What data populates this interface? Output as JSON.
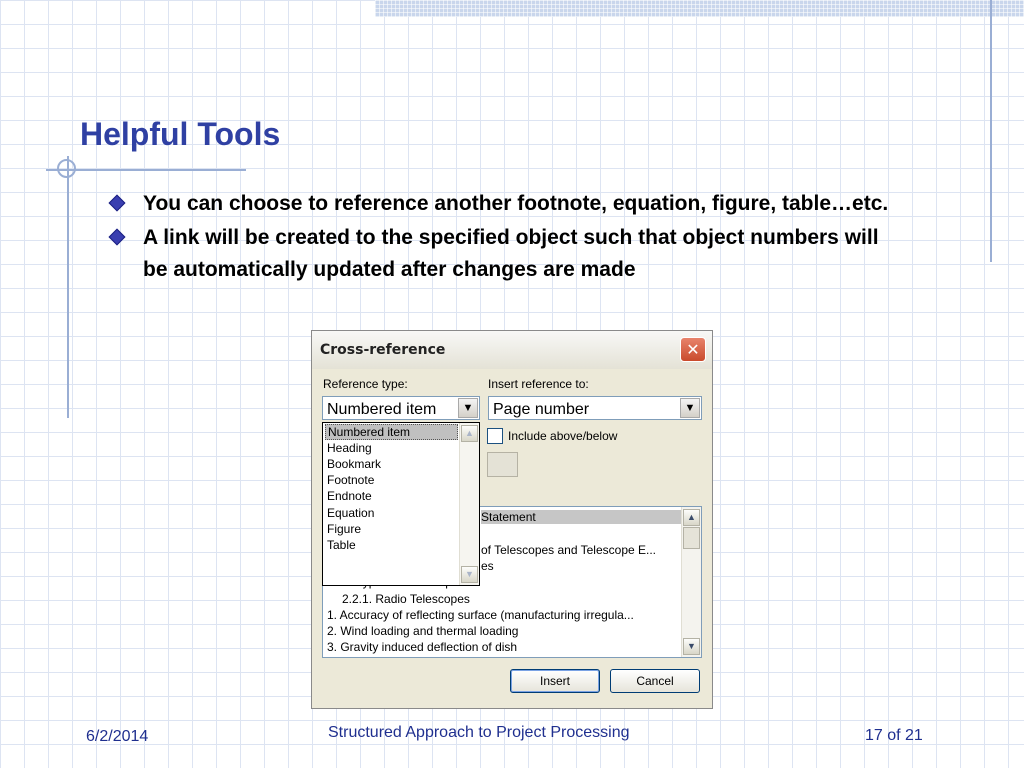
{
  "slide": {
    "title": "Helpful Tools",
    "bullets": [
      "You can choose to reference another footnote, equation, figure, table…etc.",
      "A link will be created to the specified object such that object numbers will be automatically updated after changes are made"
    ]
  },
  "dialog": {
    "title": "Cross-reference",
    "close_glyph": "✕",
    "reference_type_label": "Reference type:",
    "reference_type_value": "Numbered item",
    "insert_reference_label": "Insert reference to:",
    "insert_reference_value": "Page number",
    "include_label": "Include above/below",
    "reference_type_options": [
      "Numbered item",
      "Heading",
      "Bookmark",
      "Footnote",
      "Endnote",
      "Equation",
      "Figure",
      "Table"
    ],
    "references": [
      "Statement",
      "of Telescopes and Telescope E...",
      "es",
      "2.1. Types of Telescopes",
      "2.2.1. Radio Telescopes",
      "1. Accuracy of reflecting surface (manufacturing irregula...",
      "2. Wind loading and thermal loading",
      "3. Gravity induced deflection of dish"
    ],
    "insert_button": "Insert",
    "cancel_button": "Cancel"
  },
  "footer": {
    "date": "6/2/2014",
    "center": "Structured Approach to Project Processing",
    "page": "17 of 21"
  },
  "colors": {
    "title": "#2f40a3",
    "footer": "#1f2f8f",
    "dialog_bg": "#ece9d8"
  }
}
